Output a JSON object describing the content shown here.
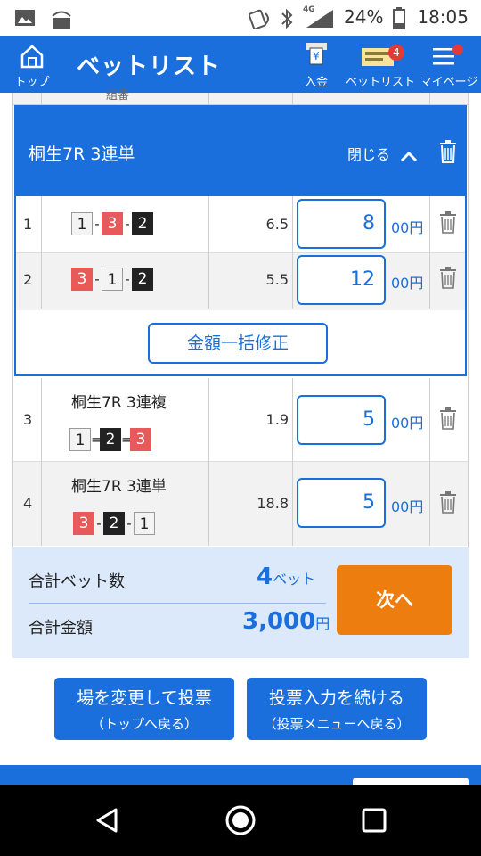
{
  "status_bar": {
    "battery_pct": "24%",
    "time": "18:05",
    "network": "4G"
  },
  "header": {
    "title": "ベットリスト",
    "top_label": "トップ",
    "deposit_label": "入金",
    "betlist_label": "ベットリスト",
    "betlist_badge": "4",
    "mypage_label": "マイページ"
  },
  "table": {
    "partial_header": "組番"
  },
  "expanded_group": {
    "race": "桐生7R 3連単",
    "close_label": "閉じる",
    "rows": [
      {
        "num": "1",
        "combo": [
          "1",
          "3",
          "2"
        ],
        "odds": "6.5",
        "amount": "8",
        "unit": "00円"
      },
      {
        "num": "2",
        "combo": [
          "3",
          "1",
          "2"
        ],
        "odds": "5.5",
        "amount": "12",
        "unit": "00円"
      }
    ],
    "bulk_label": "金額一括修正"
  },
  "bets": [
    {
      "num": "3",
      "race": "桐生7R 3連複",
      "combo": [
        "1",
        "2",
        "3"
      ],
      "sep": "=",
      "odds": "1.9",
      "amount": "5",
      "unit": "00円"
    },
    {
      "num": "4",
      "race": "桐生7R 3連単",
      "combo": [
        "3",
        "2",
        "1"
      ],
      "sep": "-",
      "odds": "18.8",
      "amount": "5",
      "unit": "00円"
    }
  ],
  "combo_sep": "-",
  "totals": {
    "count_label": "合計ベット数",
    "count_value": "4",
    "count_unit": "ベット",
    "amount_label": "合計金額",
    "amount_value": "3,000",
    "amount_unit": "円",
    "next_label": "次へ"
  },
  "actions": {
    "change_venue_l1": "場を変更して投票",
    "change_venue_l2": "（トップへ戻る）",
    "continue_l1": "投票入力を続ける",
    "continue_l2": "（投票メニューへ戻る）"
  },
  "colors": {
    "brand": "#1a6fdc",
    "accent": "#ee7d10",
    "boat1": "#f3f3f3",
    "boat2": "#222222",
    "boat3": "#e85a5a"
  }
}
